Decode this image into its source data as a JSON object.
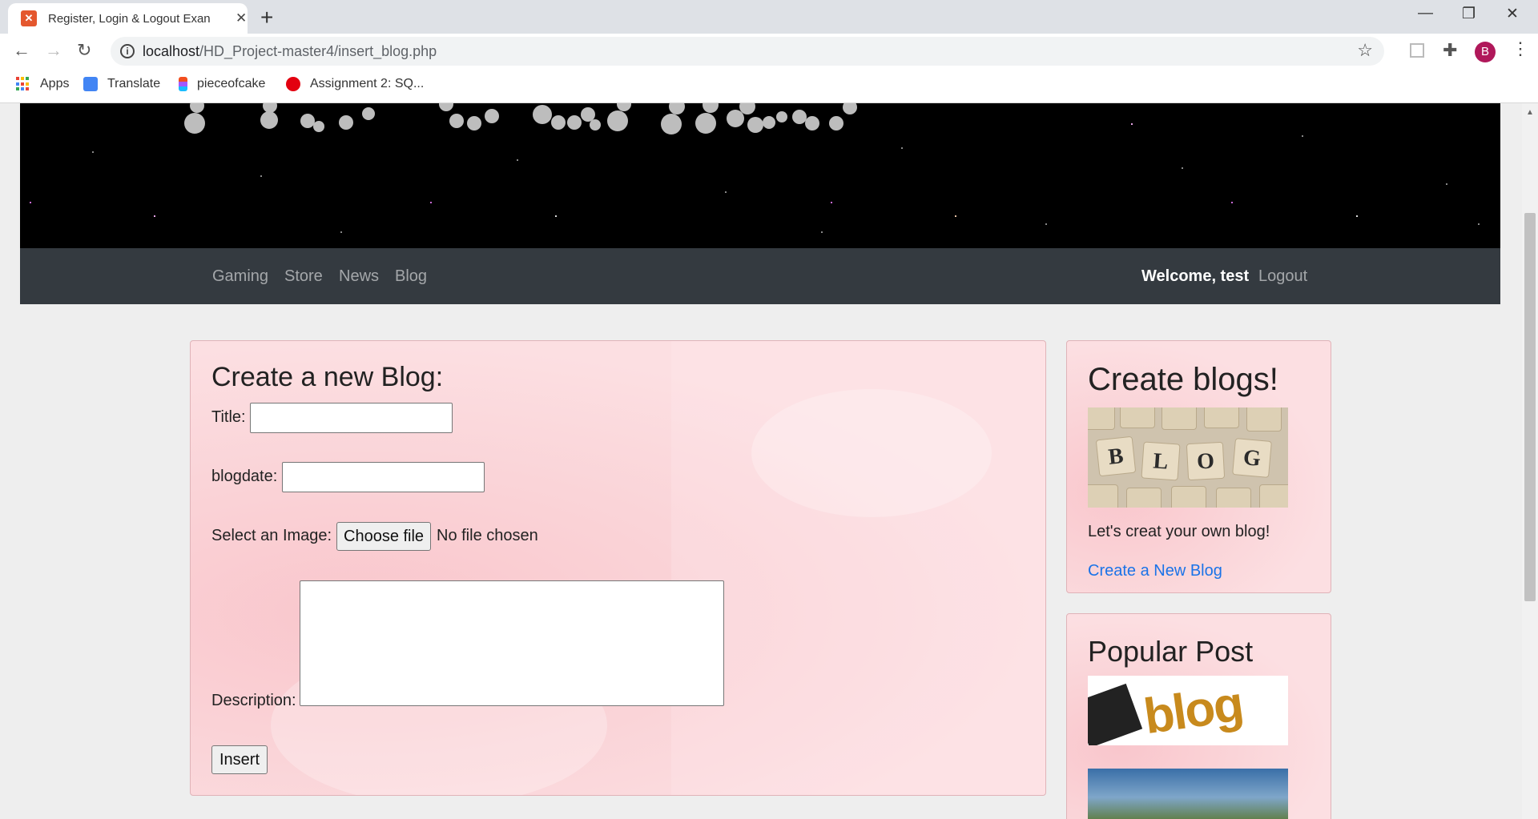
{
  "browser": {
    "tab_title": "Register, Login & Logout Exan",
    "tab_favicon": "xampp-icon",
    "url_host": "localhost",
    "url_path": "/HD_Project-master4/insert_blog.php",
    "profile_initial": "B",
    "bookmarks": [
      {
        "label": "Apps",
        "icon": "apps-grid-icon"
      },
      {
        "label": "Translate",
        "icon": "translate-icon"
      },
      {
        "label": "pieceofcake",
        "icon": "figma-icon"
      },
      {
        "label": "Assignment 2: SQ...",
        "icon": "red-blob-icon"
      }
    ]
  },
  "navbar": {
    "links": [
      "Gaming",
      "Store",
      "News",
      "Blog"
    ],
    "welcome": "Welcome, test",
    "logout": "Logout"
  },
  "form": {
    "heading": "Create a new Blog:",
    "title_label": "Title:",
    "title_value": "",
    "blogdate_label": "blogdate:",
    "blogdate_value": "",
    "image_label": "Select an Image:",
    "choose_file": "Choose file",
    "no_file": "No file chosen",
    "description_label": "Description:",
    "description_value": "",
    "submit": "Insert"
  },
  "sidebar": {
    "create": {
      "heading": "Create blogs!",
      "tiles": [
        "B",
        "L",
        "O",
        "G"
      ],
      "text": "Let's creat your own blog!",
      "link": "Create a New Blog"
    },
    "popular": {
      "heading": "Popular Post",
      "image_word": "blog"
    }
  },
  "colors": {
    "navbar_bg": "#343a40",
    "link": "#1a73e8",
    "card_bg": "#fbd6da"
  }
}
